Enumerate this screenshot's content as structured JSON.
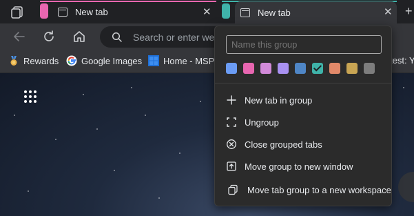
{
  "tabs": {
    "tab1_title": "New tab",
    "tab2_title": "New tab"
  },
  "group_colors": {
    "pink": "#e866b0",
    "teal": "#3fb3a9"
  },
  "toolbar": {
    "address_placeholder": "Search or enter web"
  },
  "favorites": {
    "items": [
      {
        "label": "Rewards",
        "icon": "rewards-medal-icon"
      },
      {
        "label": "Google Images",
        "icon": "google-icon"
      },
      {
        "label": "Home - MSPo",
        "icon": "microsoft-icon"
      },
      {
        "label": "test: Y",
        "icon": "partial-favorite"
      }
    ]
  },
  "menu": {
    "name_placeholder": "Name this group",
    "swatches": [
      {
        "color": "#6b9cf5",
        "name": "blue"
      },
      {
        "color": "#e866b0",
        "name": "pink"
      },
      {
        "color": "#d28ad9",
        "name": "purple"
      },
      {
        "color": "#a991f1",
        "name": "violet"
      },
      {
        "color": "#4f86c6",
        "name": "steel-blue"
      },
      {
        "color": "#3fb3a9",
        "name": "teal",
        "selected": true
      },
      {
        "color": "#e28969",
        "name": "orange"
      },
      {
        "color": "#c9a553",
        "name": "gold"
      },
      {
        "color": "#7d7d7d",
        "name": "grey"
      }
    ],
    "items": [
      {
        "label": "New tab in group",
        "icon": "plus-icon"
      },
      {
        "label": "Ungroup",
        "icon": "ungroup-icon"
      },
      {
        "label": "Close grouped tabs",
        "icon": "close-circle-icon"
      },
      {
        "label": "Move group to new window",
        "icon": "move-window-icon"
      },
      {
        "label": "Move tab group to a new workspace",
        "icon": "workspace-icon"
      }
    ]
  }
}
